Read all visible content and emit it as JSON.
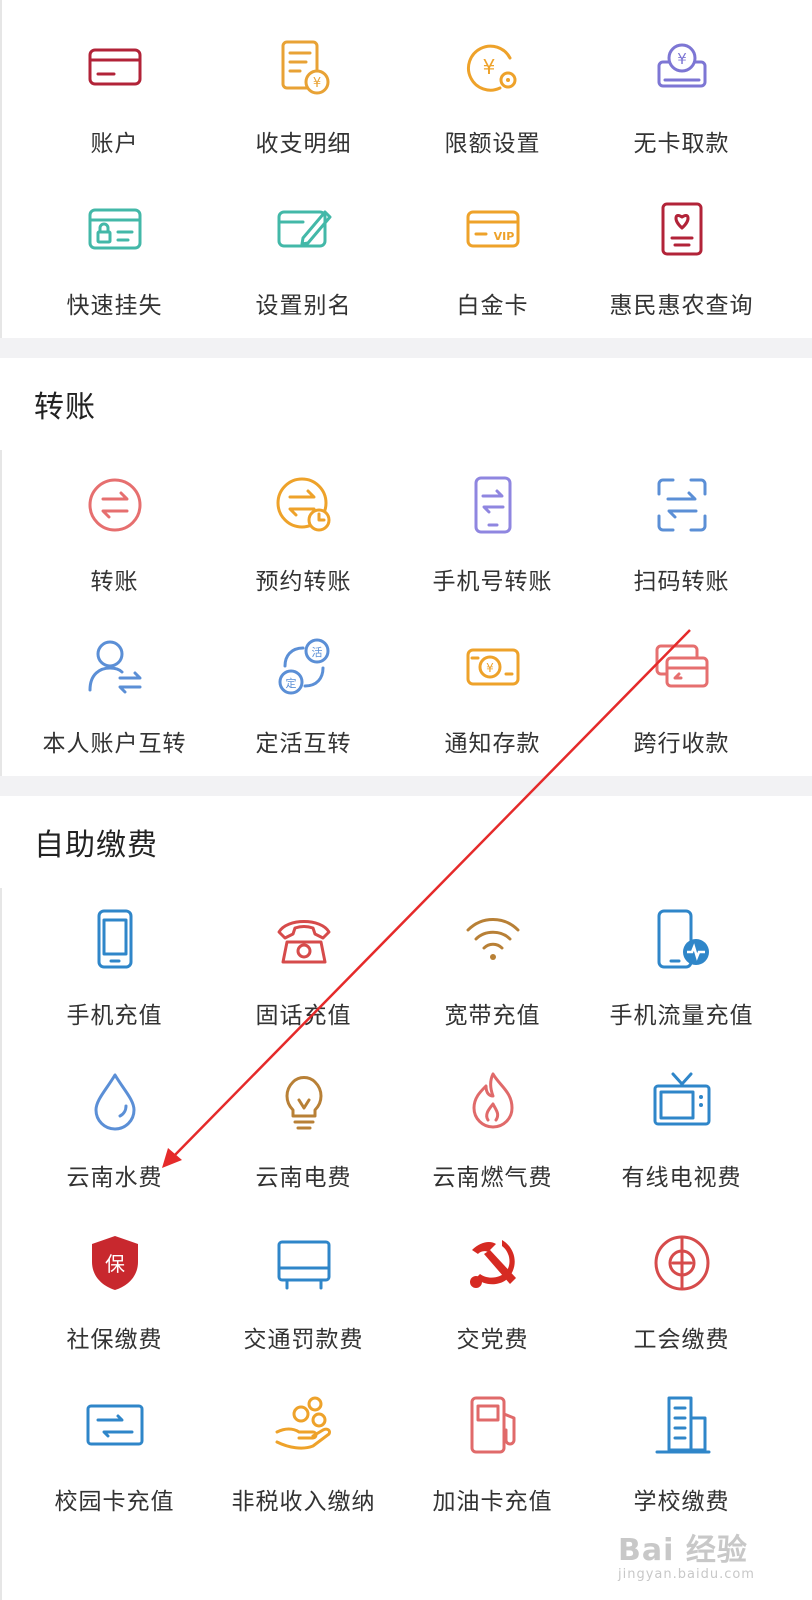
{
  "account_section": {
    "items": [
      {
        "label": "账户",
        "icon": "card-icon",
        "color": "#b22338"
      },
      {
        "label": "收支明细",
        "icon": "statement-icon",
        "color": "#e8a235"
      },
      {
        "label": "限额设置",
        "icon": "limit-setting-icon",
        "color": "#eea22a"
      },
      {
        "label": "无卡取款",
        "icon": "cardless-withdraw-icon",
        "color": "#7d76d4"
      },
      {
        "label": "快速挂失",
        "icon": "report-loss-icon",
        "color": "#43b8a8"
      },
      {
        "label": "设置别名",
        "icon": "edit-card-icon",
        "color": "#43b8a8"
      },
      {
        "label": "白金卡",
        "icon": "vip-card-icon",
        "color": "#eea22a"
      },
      {
        "label": "惠民惠农查询",
        "icon": "benefit-query-icon",
        "color": "#b22338"
      }
    ]
  },
  "transfer_section": {
    "title": "转账",
    "items": [
      {
        "label": "转账",
        "icon": "transfer-icon",
        "color": "#e66f6f"
      },
      {
        "label": "预约转账",
        "icon": "scheduled-transfer-icon",
        "color": "#eea22a"
      },
      {
        "label": "手机号转账",
        "icon": "phone-transfer-icon",
        "color": "#8f86e0"
      },
      {
        "label": "扫码转账",
        "icon": "scan-transfer-icon",
        "color": "#5b8fd6"
      },
      {
        "label": "本人账户互转",
        "icon": "own-account-transfer-icon",
        "color": "#5b8fd6"
      },
      {
        "label": "定活互转",
        "icon": "fixed-current-transfer-icon",
        "color": "#5b8fd6"
      },
      {
        "label": "通知存款",
        "icon": "notice-deposit-icon",
        "color": "#eea22a"
      },
      {
        "label": "跨行收款",
        "icon": "interbank-collect-icon",
        "color": "#e66f6f"
      }
    ]
  },
  "payment_section": {
    "title": "自助缴费",
    "items": [
      {
        "label": "手机充值",
        "icon": "mobile-recharge-icon",
        "color": "#2f86c9"
      },
      {
        "label": "固话充值",
        "icon": "telephone-icon",
        "color": "#d64b4b"
      },
      {
        "label": "宽带充值",
        "icon": "wifi-icon",
        "color": "#b88036"
      },
      {
        "label": "手机流量充值",
        "icon": "mobile-data-icon",
        "color": "#2f86c9"
      },
      {
        "label": "云南水费",
        "icon": "water-drop-icon",
        "color": "#5b8fd6"
      },
      {
        "label": "云南电费",
        "icon": "lightbulb-icon",
        "color": "#b88036"
      },
      {
        "label": "云南燃气费",
        "icon": "flame-icon",
        "color": "#e06a6a"
      },
      {
        "label": "有线电视费",
        "icon": "tv-icon",
        "color": "#2f86c9"
      },
      {
        "label": "社保缴费",
        "icon": "social-security-shield-icon",
        "color": "#c8282e"
      },
      {
        "label": "交通罚款费",
        "icon": "traffic-fine-icon",
        "color": "#2f86c9"
      },
      {
        "label": "交党费",
        "icon": "party-emblem-icon",
        "color": "#d62a22"
      },
      {
        "label": "工会缴费",
        "icon": "trade-union-icon",
        "color": "#d64b4b"
      },
      {
        "label": "校园卡充值",
        "icon": "campus-card-icon",
        "color": "#2f86c9"
      },
      {
        "label": "非税收入缴纳",
        "icon": "non-tax-payment-icon",
        "color": "#eea22a"
      },
      {
        "label": "加油卡充值",
        "icon": "gas-station-icon",
        "color": "#e06a6a"
      },
      {
        "label": "学校缴费",
        "icon": "school-building-icon",
        "color": "#2f86c9"
      }
    ]
  },
  "watermark": {
    "main": "Bai 经验",
    "sub": "jingyan.baidu.com"
  },
  "annotation": {
    "color": "#e52a2a"
  }
}
